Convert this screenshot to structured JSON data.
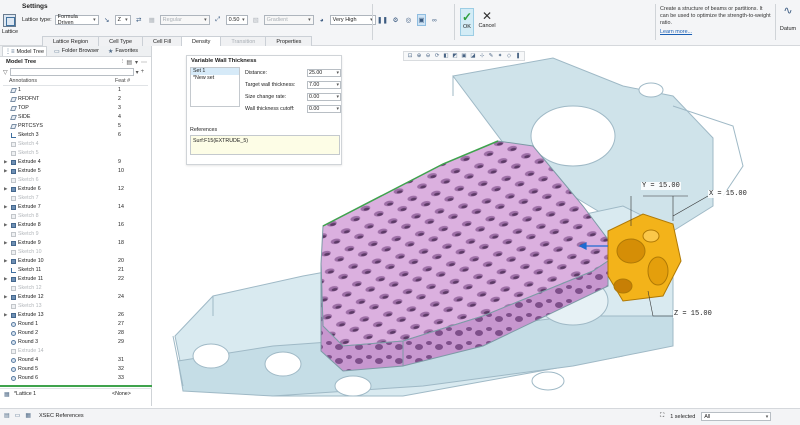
{
  "ribbon": {
    "title": "Settings",
    "app_label": "Lattice",
    "lattice_type_label": "Lattice type:",
    "lattice_type_value": "Formula Driven",
    "axis_value": "Z",
    "regular_value": "Regular",
    "size_value": "0.50",
    "gradient_value": "Gradient",
    "quality_value": "Very High",
    "tabs": [
      {
        "label": "Lattice Region",
        "disabled": false
      },
      {
        "label": "Cell Type",
        "disabled": false
      },
      {
        "label": "Cell Fill",
        "disabled": false
      },
      {
        "label": "Density",
        "disabled": false
      },
      {
        "label": "Transition",
        "disabled": true
      },
      {
        "label": "Properties",
        "disabled": false
      }
    ],
    "ok_label": "OK",
    "cancel_label": "Cancel",
    "help_text": "Create a structure of beams or partitions. It can be used to optimize the strength-to-weight ratio.",
    "learn_more": "Learn more...",
    "datum_label": "Datum"
  },
  "left_panel": {
    "tabs": [
      {
        "label": "Model Tree",
        "icon": "model-tree-icon",
        "active": true
      },
      {
        "label": "Folder Browser",
        "icon": "folder-icon",
        "active": false
      },
      {
        "label": "Favorites",
        "icon": "star-icon",
        "active": false
      }
    ],
    "model_tree_title": "Model Tree",
    "columns": {
      "name": "Annotations",
      "feat": "Feat #"
    },
    "rows": [
      {
        "name": "1",
        "feat": "1",
        "icon": "plane",
        "suppressed": false,
        "expand": false
      },
      {
        "name": "RFDFNT",
        "feat": "2",
        "icon": "plane",
        "suppressed": false,
        "expand": false
      },
      {
        "name": "TOP",
        "feat": "3",
        "icon": "plane",
        "suppressed": false,
        "expand": false
      },
      {
        "name": "SIDE",
        "feat": "4",
        "icon": "plane",
        "suppressed": false,
        "expand": false
      },
      {
        "name": "PRTCSYS",
        "feat": "5",
        "icon": "plane",
        "suppressed": false,
        "expand": false
      },
      {
        "name": "Sketch 3",
        "feat": "6",
        "icon": "sketch",
        "suppressed": false,
        "expand": false
      },
      {
        "name": "Sketch 4",
        "feat": "",
        "icon": "sup",
        "suppressed": true,
        "expand": false
      },
      {
        "name": "Sketch 5",
        "feat": "",
        "icon": "sup",
        "suppressed": true,
        "expand": false
      },
      {
        "name": "Extrude 4",
        "feat": "9",
        "icon": "feat",
        "suppressed": false,
        "expand": true
      },
      {
        "name": "Extrude 5",
        "feat": "10",
        "icon": "feat",
        "suppressed": false,
        "expand": true
      },
      {
        "name": "Sketch 6",
        "feat": "",
        "icon": "sup",
        "suppressed": true,
        "expand": false
      },
      {
        "name": "Extrude 6",
        "feat": "12",
        "icon": "feat",
        "suppressed": false,
        "expand": true
      },
      {
        "name": "Sketch 7",
        "feat": "",
        "icon": "sup",
        "suppressed": true,
        "expand": false
      },
      {
        "name": "Extrude 7",
        "feat": "14",
        "icon": "feat",
        "suppressed": false,
        "expand": true
      },
      {
        "name": "Sketch 8",
        "feat": "",
        "icon": "sup",
        "suppressed": true,
        "expand": false
      },
      {
        "name": "Extrude 8",
        "feat": "16",
        "icon": "feat",
        "suppressed": false,
        "expand": true
      },
      {
        "name": "Sketch 9",
        "feat": "",
        "icon": "sup",
        "suppressed": true,
        "expand": false
      },
      {
        "name": "Extrude 9",
        "feat": "18",
        "icon": "feat",
        "suppressed": false,
        "expand": true
      },
      {
        "name": "Sketch 10",
        "feat": "",
        "icon": "sup",
        "suppressed": true,
        "expand": false
      },
      {
        "name": "Extrude 10",
        "feat": "20",
        "icon": "feat",
        "suppressed": false,
        "expand": true
      },
      {
        "name": "Sketch 11",
        "feat": "21",
        "icon": "sketch",
        "suppressed": false,
        "expand": false
      },
      {
        "name": "Extrude 11",
        "feat": "22",
        "icon": "feat",
        "suppressed": false,
        "expand": true
      },
      {
        "name": "Sketch 12",
        "feat": "",
        "icon": "sup",
        "suppressed": true,
        "expand": false
      },
      {
        "name": "Extrude 12",
        "feat": "24",
        "icon": "feat",
        "suppressed": false,
        "expand": true
      },
      {
        "name": "Sketch 13",
        "feat": "",
        "icon": "sup",
        "suppressed": true,
        "expand": false
      },
      {
        "name": "Extrude 13",
        "feat": "26",
        "icon": "feat",
        "suppressed": false,
        "expand": true
      },
      {
        "name": "Round 1",
        "feat": "27",
        "icon": "round",
        "suppressed": false,
        "expand": false
      },
      {
        "name": "Round 2",
        "feat": "28",
        "icon": "round",
        "suppressed": false,
        "expand": false
      },
      {
        "name": "Round 3",
        "feat": "29",
        "icon": "round",
        "suppressed": false,
        "expand": false
      },
      {
        "name": "Extrude 14",
        "feat": "",
        "icon": "sup",
        "suppressed": true,
        "expand": false
      },
      {
        "name": "Round 4",
        "feat": "31",
        "icon": "round",
        "suppressed": false,
        "expand": false
      },
      {
        "name": "Round 5",
        "feat": "32",
        "icon": "round",
        "suppressed": false,
        "expand": false
      },
      {
        "name": "Round 6",
        "feat": "33",
        "icon": "round",
        "suppressed": false,
        "expand": false
      }
    ],
    "bottom_item": {
      "name": "*Lattice 1",
      "feat": "<None>"
    }
  },
  "dialog": {
    "title": "Variable Wall Thickness",
    "sets": [
      "Set 1",
      "*New set"
    ],
    "fields": [
      {
        "label": "Distance:",
        "value": "25.00"
      },
      {
        "label": "Target wall thickness:",
        "value": "7.00"
      },
      {
        "label": "Size change rate:",
        "value": "0.00"
      },
      {
        "label": "Wall thickness cutoff:",
        "value": "0.00"
      }
    ],
    "references_label": "References",
    "references": [
      "Surf:F15(EXTRUDE_5)"
    ]
  },
  "graphics": {
    "dims": {
      "y": "Y = 15.00",
      "x": "X = 15.00",
      "z": "Z = 15.00"
    },
    "colors": {
      "lattice": "#d9a8dd",
      "part": "#c9dfe8",
      "cell": "#f3b31a"
    }
  },
  "status": {
    "refs_label": "XSEC References",
    "selected": "1 selected",
    "filter": "All"
  }
}
